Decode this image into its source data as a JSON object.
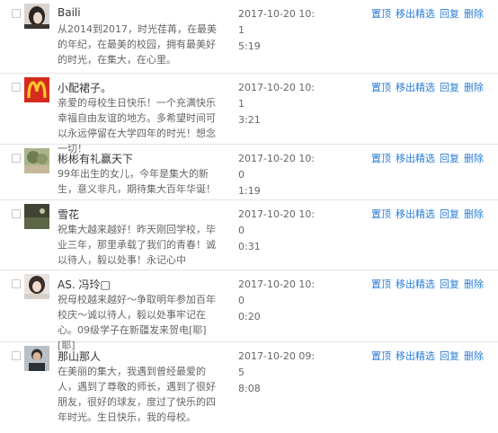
{
  "actions": {
    "top": "置顶",
    "remove_featured": "移出精选",
    "reply": "回复",
    "delete": "删除"
  },
  "comments": [
    {
      "name": "Baili",
      "content": "从2014到2017，时光荏苒，在最美的年纪，在最美的校园，拥有最美好的时光，在集大，在心里。",
      "time_line1": "2017-10-20 10:1",
      "time_line2": "5:19",
      "avatar_icon": "avatar-girl-photo-icon"
    },
    {
      "name": "小配裙子。",
      "content": "亲爱的母校生日快乐！一个充满快乐幸福自由友谊的地方。多希望时间可以永远停留在大学四年的时光！想念一切！",
      "time_line1": "2017-10-20 10:1",
      "time_line2": "3:21",
      "avatar_icon": "mcdonalds-logo-icon"
    },
    {
      "name": "彬彬有礼赢天下",
      "content": "99年出生的女儿，今年是集大的新生，意义非凡，期待集大百年华诞！",
      "time_line1": "2017-10-20 10:0",
      "time_line2": "1:19",
      "avatar_icon": "avatar-landscape-photo-icon"
    },
    {
      "name": "雪花",
      "content": "祝集大越来越好！昨天刚回学校，毕业三年，那里承载了我们的青春！诚以待人，毅以处事！永记心中",
      "time_line1": "2017-10-20 10:0",
      "time_line2": "0:31",
      "avatar_icon": "avatar-dark-scene-icon"
    },
    {
      "name": "AS. 冯玲□",
      "content": "祝母校越来越好～争取明年参加百年校庆～诚以待人，毅以处事牢记在心。09级学子在新疆发来贺电[耶][耶]",
      "time_line1": "2017-10-20 10:0",
      "time_line2": "0:20",
      "avatar_icon": "avatar-woman-portrait-icon"
    },
    {
      "name": "那山那人",
      "content": "在美丽的集大，我遇到曾经最爱的人，遇到了尊敬的师长，遇到了很好朋友，很好的球友，度过了快乐的四年时光。生日快乐，我的母校。",
      "time_line1": "2017-10-20 09:5",
      "time_line2": "8:08",
      "avatar_icon": "avatar-man-portrait-icon"
    }
  ]
}
